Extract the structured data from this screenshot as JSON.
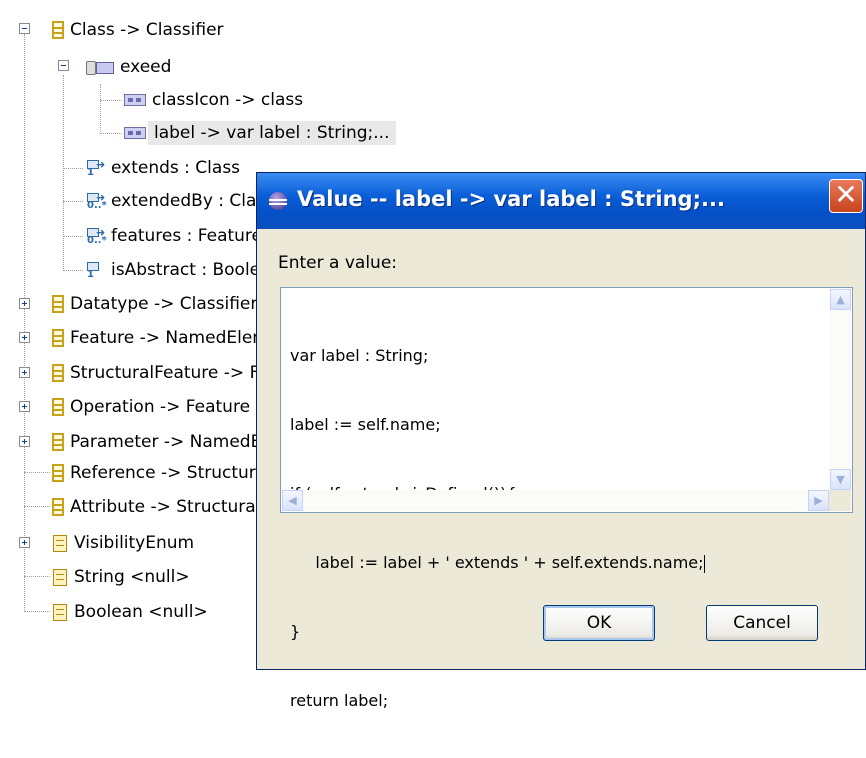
{
  "tree": {
    "items": [
      {
        "label": "Class -> Classifier",
        "icon": "eclass-icon"
      },
      {
        "label": "exeed",
        "icon": "eannotation-icon"
      },
      {
        "label": "classIcon -> class",
        "icon": "details-entry-icon"
      },
      {
        "label": "label -> var label : String;...",
        "icon": "details-entry-icon",
        "selected": true
      },
      {
        "label": "extends : Class",
        "icon": "ereference-icon"
      },
      {
        "label": "extendedBy : Class",
        "icon": "ereference-many-icon"
      },
      {
        "label": "features : Feature",
        "icon": "ereference-many-icon"
      },
      {
        "label": "isAbstract : Boolean",
        "icon": "eattribute-icon"
      },
      {
        "label": "Datatype -> Classifier",
        "icon": "eclass-icon"
      },
      {
        "label": "Feature -> NamedElement",
        "icon": "eclass-icon"
      },
      {
        "label": "StructuralFeature -> Feature",
        "icon": "eclass-icon"
      },
      {
        "label": "Operation -> Feature",
        "icon": "eclass-icon"
      },
      {
        "label": "Parameter -> NamedElement",
        "icon": "eclass-icon"
      },
      {
        "label": "Reference -> StructuralFeature",
        "icon": "eclass-icon"
      },
      {
        "label": "Attribute -> StructuralFeature",
        "icon": "eclass-icon"
      },
      {
        "label": "VisibilityEnum",
        "icon": "eenum-icon"
      },
      {
        "label": "String <null>",
        "icon": "edatatype-icon"
      },
      {
        "label": "Boolean <null>",
        "icon": "edatatype-icon"
      }
    ]
  },
  "dialog": {
    "title": "Value -- label -> var label : String;...",
    "close_label": "✕",
    "prompt": "Enter a value:",
    "code_lines": [
      "var label : String;",
      "label := self.name;",
      "if (self.extends.isDefined()){",
      "     label := label + ' extends ' + self.extends.name;",
      "}",
      "return label;"
    ],
    "ok_label": "OK",
    "cancel_label": "Cancel"
  }
}
